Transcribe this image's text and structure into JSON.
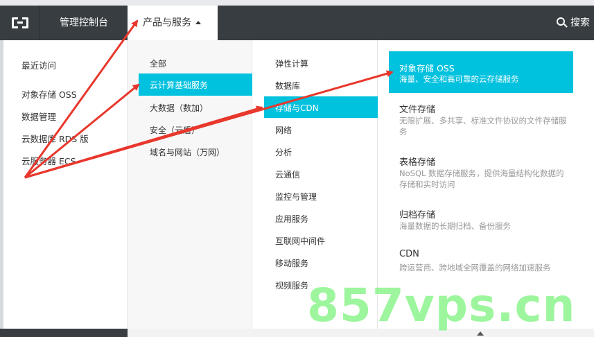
{
  "topnav": {
    "console_label": "管理控制台",
    "products_label": "产品与服务",
    "search_label": "搜索"
  },
  "recent": {
    "header": "最近访问",
    "items": [
      "对象存储 OSS",
      "数据管理",
      "云数据库 RDS 版",
      "云服务器 ECS"
    ]
  },
  "categories": {
    "items": [
      "全部",
      "云计算基础服务",
      "大数据（数加）",
      "安全（云盾）",
      "域名与网站（万网）"
    ]
  },
  "subcategories": {
    "items": [
      "弹性计算",
      "数据库",
      "存储与CDN",
      "网络",
      "分析",
      "云通信",
      "监控与管理",
      "应用服务",
      "互联网中间件",
      "移动服务",
      "视频服务"
    ]
  },
  "products": {
    "items": [
      {
        "title": "对象存储 OSS",
        "desc": "海量、安全和高可靠的云存储服务"
      },
      {
        "title": "文件存储",
        "desc": "无限扩展、多共享、标准文件协议的文件存储服务"
      },
      {
        "title": "表格存储",
        "desc": "NoSQL 数据存储服务，提供海量结构化数据的存储和实时访问"
      },
      {
        "title": "归档存储",
        "desc": "海量数据的长期归档、备份服务"
      },
      {
        "title": "CDN",
        "desc": "跨运营商、跨地域全网覆盖的网络加速服务"
      }
    ]
  },
  "watermark": "857vps.cn",
  "colors": {
    "highlight": "#00c1de",
    "nav_bg": "#373d41",
    "arrow": "#e8372c"
  }
}
